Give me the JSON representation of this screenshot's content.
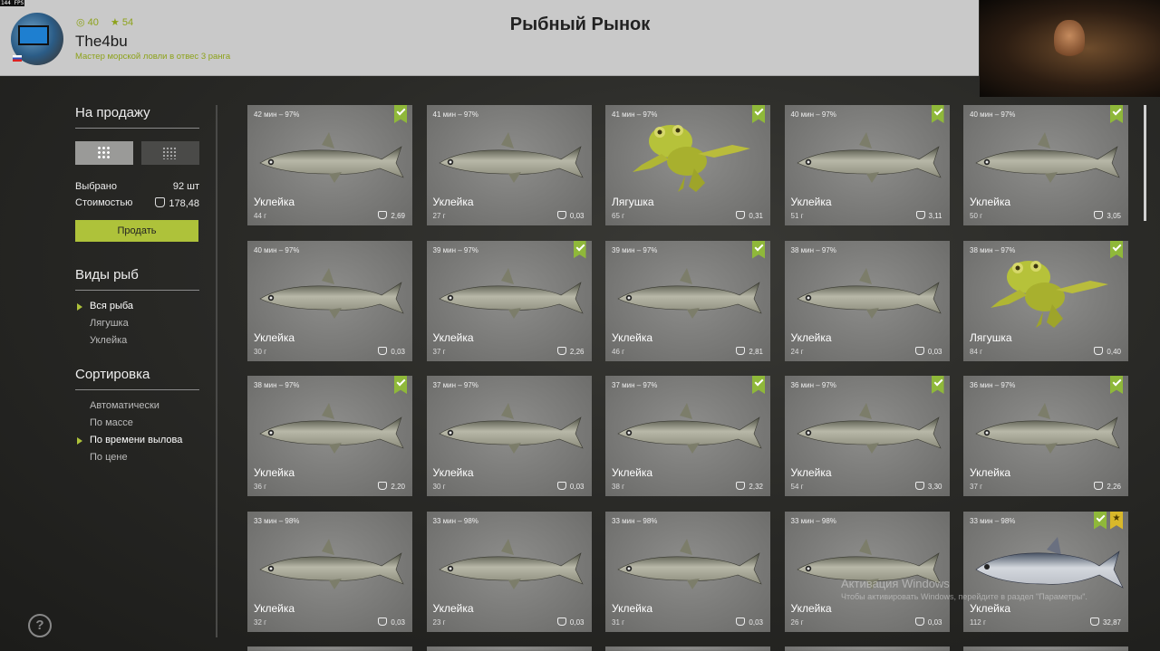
{
  "fps": "144 FPS",
  "player": {
    "coins": "40",
    "stars": "54",
    "name": "The4bu",
    "rank": "Мастер морской ловли в отвес 3 ранга"
  },
  "title": "Рыбный Рынок",
  "sale": {
    "heading": "На продажу",
    "selected_label": "Выбрано",
    "selected_value": "92 шт",
    "cost_label": "Стоимостью",
    "cost_value": "178,48",
    "sell_button": "Продать"
  },
  "species": {
    "heading": "Виды рыб",
    "items": [
      "Вся рыба",
      "Лягушка",
      "Уклейка"
    ],
    "selected_index": 0
  },
  "sorting": {
    "heading": "Сортировка",
    "items": [
      "Автоматически",
      "По массе",
      "По времени вылова",
      "По цене"
    ],
    "selected_index": 2
  },
  "cards": [
    {
      "meta": "42 мин – 97%",
      "name": "Уклейка",
      "weight": "44 г",
      "price": "2,69",
      "kind": "bleak",
      "checked": true
    },
    {
      "meta": "41 мин – 97%",
      "name": "Уклейка",
      "weight": "27 г",
      "price": "0,03",
      "kind": "bleak",
      "checked": false
    },
    {
      "meta": "41 мин – 97%",
      "name": "Лягушка",
      "weight": "65 г",
      "price": "0,31",
      "kind": "frog",
      "checked": true
    },
    {
      "meta": "40 мин – 97%",
      "name": "Уклейка",
      "weight": "51 г",
      "price": "3,11",
      "kind": "bleak",
      "checked": true
    },
    {
      "meta": "40 мин – 97%",
      "name": "Уклейка",
      "weight": "50 г",
      "price": "3,05",
      "kind": "bleak",
      "checked": true
    },
    {
      "meta": "40 мин – 97%",
      "name": "Уклейка",
      "weight": "30 г",
      "price": "0,03",
      "kind": "bleak",
      "checked": false
    },
    {
      "meta": "39 мин – 97%",
      "name": "Уклейка",
      "weight": "37 г",
      "price": "2,26",
      "kind": "bleak",
      "checked": true
    },
    {
      "meta": "39 мин – 97%",
      "name": "Уклейка",
      "weight": "46 г",
      "price": "2,81",
      "kind": "bleak",
      "checked": true
    },
    {
      "meta": "38 мин – 97%",
      "name": "Уклейка",
      "weight": "24 г",
      "price": "0,03",
      "kind": "bleak",
      "checked": false
    },
    {
      "meta": "38 мин – 97%",
      "name": "Лягушка",
      "weight": "84 г",
      "price": "0,40",
      "kind": "frog",
      "checked": true
    },
    {
      "meta": "38 мин – 97%",
      "name": "Уклейка",
      "weight": "36 г",
      "price": "2,20",
      "kind": "bleak",
      "checked": true
    },
    {
      "meta": "37 мин – 97%",
      "name": "Уклейка",
      "weight": "30 г",
      "price": "0,03",
      "kind": "bleak",
      "checked": false
    },
    {
      "meta": "37 мин – 97%",
      "name": "Уклейка",
      "weight": "38 г",
      "price": "2,32",
      "kind": "bleak",
      "checked": true
    },
    {
      "meta": "36 мин – 97%",
      "name": "Уклейка",
      "weight": "54 г",
      "price": "3,30",
      "kind": "bleak",
      "checked": true
    },
    {
      "meta": "36 мин – 97%",
      "name": "Уклейка",
      "weight": "37 г",
      "price": "2,26",
      "kind": "bleak",
      "checked": true
    },
    {
      "meta": "33 мин – 98%",
      "name": "Уклейка",
      "weight": "32 г",
      "price": "0,03",
      "kind": "bleak",
      "checked": false
    },
    {
      "meta": "33 мин – 98%",
      "name": "Уклейка",
      "weight": "23 г",
      "price": "0,03",
      "kind": "bleak",
      "checked": false
    },
    {
      "meta": "33 мин – 98%",
      "name": "Уклейка",
      "weight": "31 г",
      "price": "0,03",
      "kind": "bleak",
      "checked": false
    },
    {
      "meta": "33 мин – 98%",
      "name": "Уклейка",
      "weight": "26 г",
      "price": "0,03",
      "kind": "bleak",
      "checked": false
    },
    {
      "meta": "33 мин – 98%",
      "name": "Уклейка",
      "weight": "112 г",
      "price": "32,87",
      "kind": "silver",
      "checked": true,
      "starred": true
    }
  ],
  "watermark": {
    "line1": "Активация Windows",
    "line2": "Чтобы активировать Windows, перейдите в раздел \"Параметры\"."
  },
  "help": "?"
}
